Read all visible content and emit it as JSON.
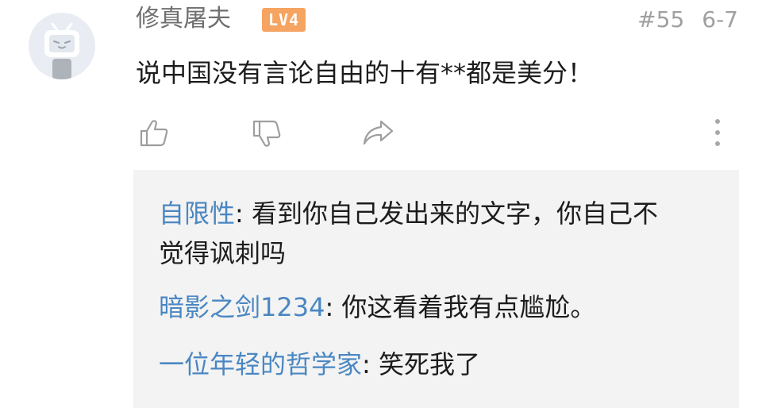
{
  "comment": {
    "username": "修真屠夫",
    "level": "LV4",
    "floor": "#55",
    "date": "6-7",
    "text": "说中国没有言论自由的十有**都是美分！"
  },
  "actions": {
    "like_icon": "thumb-up-icon",
    "dislike_icon": "thumb-down-icon",
    "share_icon": "share-icon",
    "more_icon": "more-vertical-icon"
  },
  "replies": [
    {
      "user": "自限性",
      "sep": ": ",
      "text": "看到你自己发出来的文字，你自己不觉得讽刺吗"
    },
    {
      "user": "暗影之剑1234",
      "sep": ": ",
      "text": "你这看着我有点尴尬。"
    },
    {
      "user": "一位年轻的哲学家",
      "sep": ": ",
      "text": "笑死我了"
    }
  ],
  "colors": {
    "reply_user": "#4a87c2",
    "level_badge": "#f5a461",
    "reply_bg": "#f3f3f3",
    "meta": "#a0a0a0"
  }
}
